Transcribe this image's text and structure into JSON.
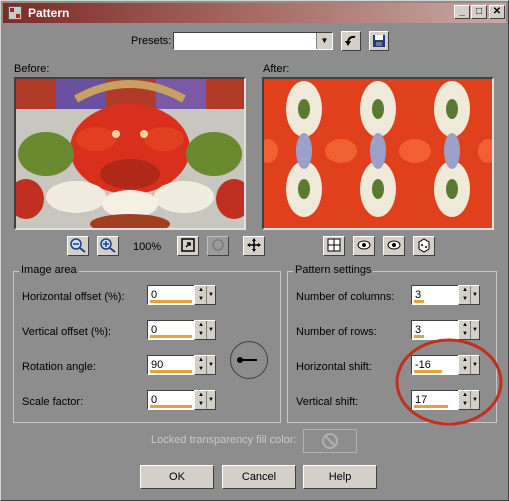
{
  "window": {
    "title": "Pattern"
  },
  "titlebar_buttons": [
    "_",
    "□",
    "✕"
  ],
  "presets": {
    "label": "Presets:",
    "value": ""
  },
  "before": {
    "label": "Before:"
  },
  "after": {
    "label": "After:"
  },
  "zoom": {
    "level": "100%"
  },
  "image_area": {
    "title": "Image area",
    "fields": [
      {
        "label": "Horizontal offset (%):",
        "value": "0"
      },
      {
        "label": "Vertical offset (%):",
        "value": "0"
      },
      {
        "label": "Rotation angle:",
        "value": "90"
      },
      {
        "label": "Scale factor:",
        "value": "0"
      }
    ]
  },
  "pattern_settings": {
    "title": "Pattern settings",
    "fields": [
      {
        "label": "Number of columns:",
        "value": "3"
      },
      {
        "label": "Number of rows:",
        "value": "3"
      },
      {
        "label": "Horizontal shift:",
        "value": "-16"
      },
      {
        "label": "Vertical shift:",
        "value": "17"
      }
    ]
  },
  "locked_fill": {
    "label": "Locked transparency fill color:"
  },
  "buttons": {
    "ok": "OK",
    "cancel": "Cancel",
    "help": "Help"
  },
  "colors": {
    "title_start": "#7d2a24",
    "accent_orange": "#e8a040",
    "highlight_circle": "#c0301c"
  }
}
